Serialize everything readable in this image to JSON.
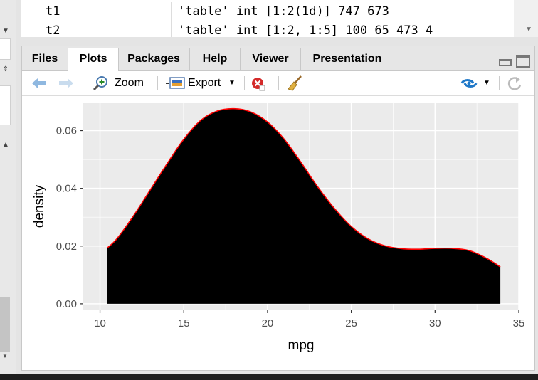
{
  "environment": {
    "rows": [
      {
        "name": "t1",
        "value": "'table' int [1:2(1d)] 747 673"
      },
      {
        "name": "t2",
        "value": "'table' int [1:2, 1:5] 100 65 473 4"
      }
    ]
  },
  "tabs": [
    {
      "label": "Files",
      "active": false
    },
    {
      "label": "Plots",
      "active": true
    },
    {
      "label": "Packages",
      "active": false
    },
    {
      "label": "Help",
      "active": false
    },
    {
      "label": "Viewer",
      "active": false
    },
    {
      "label": "Presentation",
      "active": false
    }
  ],
  "toolbar": {
    "zoom_label": "Zoom",
    "export_label": "Export"
  },
  "colors": {
    "panel_bg": "#ebebeb",
    "grid": "#ffffff",
    "fill": "#000000",
    "outline": "#ff0000",
    "accent_blue": "#1f78c8"
  },
  "chart_data": {
    "type": "area",
    "title": "",
    "xlabel": "mpg",
    "ylabel": "density",
    "xlim": [
      9,
      35
    ],
    "ylim": [
      -0.002,
      0.0695
    ],
    "x_ticks": [
      10,
      15,
      20,
      25,
      30,
      35
    ],
    "y_ticks": [
      0.0,
      0.02,
      0.04,
      0.06
    ],
    "y_tick_labels": [
      "0.00",
      "0.02",
      "0.04",
      "0.06"
    ],
    "series": [
      {
        "x": [
          10.4,
          11,
          12,
          13,
          14,
          15,
          16,
          17,
          18,
          19,
          20,
          21,
          22,
          23,
          24,
          25,
          26,
          27,
          28,
          29,
          30,
          31,
          32,
          33,
          33.9
        ],
        "y": [
          0.0192,
          0.0225,
          0.0305,
          0.0395,
          0.0485,
          0.057,
          0.0635,
          0.0668,
          0.0676,
          0.0665,
          0.063,
          0.057,
          0.049,
          0.0405,
          0.033,
          0.0268,
          0.0225,
          0.0201,
          0.0191,
          0.0189,
          0.0192,
          0.0192,
          0.0185,
          0.016,
          0.0128
        ]
      }
    ]
  }
}
